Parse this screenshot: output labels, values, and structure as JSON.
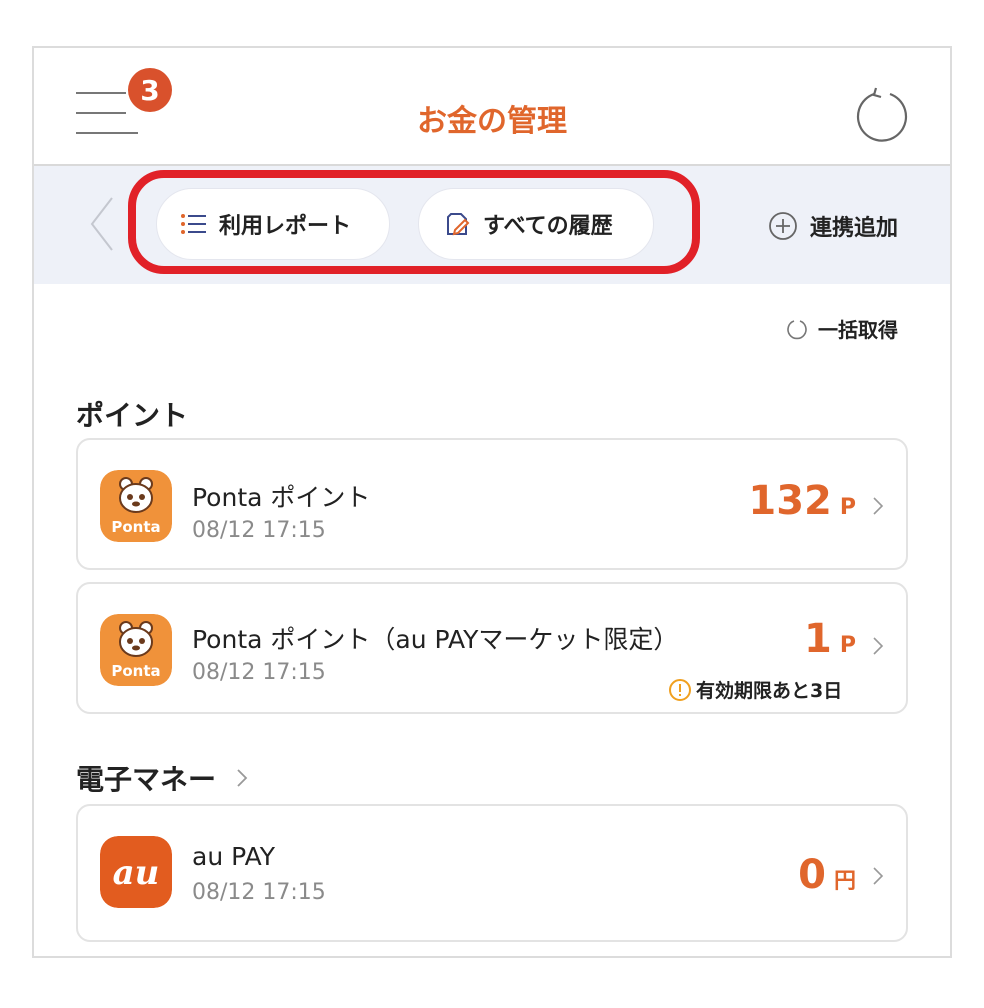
{
  "header": {
    "title": "お金の管理",
    "menu_badge_count": "3",
    "menu_icon": "hamburger-menu-icon",
    "refresh_icon": "refresh-icon"
  },
  "toolbar": {
    "report_label": "利用レポート",
    "history_label": "すべての履歴",
    "add_link_label": "連携追加"
  },
  "bulk_fetch_label": "一括取得",
  "sections": {
    "points_title": "ポイント",
    "emoney_title": "電子マネー"
  },
  "points": [
    {
      "name": "Ponta ポイント",
      "updated": "08/12 17:15",
      "amount": "132",
      "unit": "P",
      "logo_text": "Ponta"
    },
    {
      "name": "Ponta ポイント（au PAYマーケット限定）",
      "updated": "08/12 17:15",
      "amount": "1",
      "unit": "P",
      "logo_text": "Ponta",
      "warning": "有効期限あと3日"
    }
  ],
  "emoney": [
    {
      "name": "au PAY",
      "updated": "08/12 17:15",
      "amount": "0",
      "unit": "円",
      "logo_text": "au"
    }
  ],
  "colors": {
    "accent": "#e0662c",
    "badge": "#d9512c",
    "highlight": "#e12128",
    "toolbar_bg": "#eef1f8"
  }
}
